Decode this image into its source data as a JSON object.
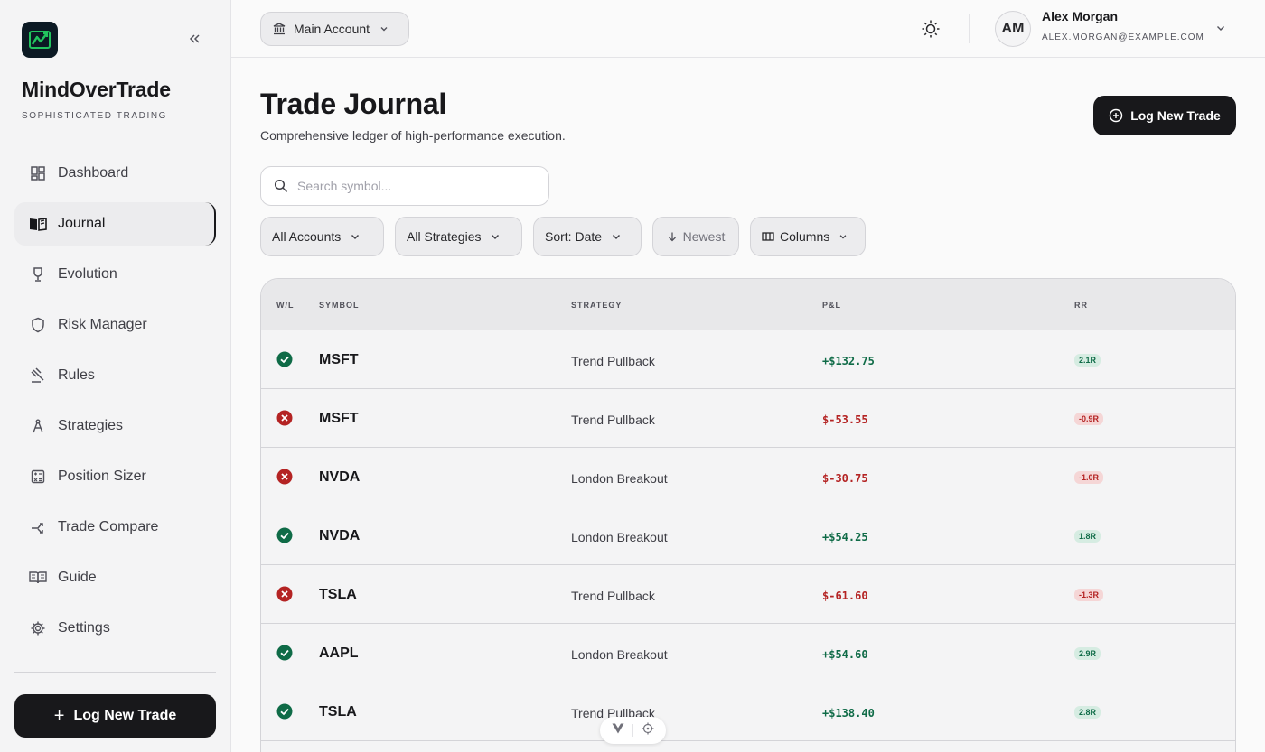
{
  "sidebar": {
    "brand": "MindOverTrade",
    "tagline": "SOPHISTICATED TRADING",
    "items": [
      {
        "label": "Dashboard",
        "icon": "dashboard-icon",
        "active": false
      },
      {
        "label": "Journal",
        "icon": "book-open-icon",
        "active": true
      },
      {
        "label": "Evolution",
        "icon": "trophy-icon",
        "active": false
      },
      {
        "label": "Risk Manager",
        "icon": "shield-icon",
        "active": false
      },
      {
        "label": "Rules",
        "icon": "gavel-icon",
        "active": false
      },
      {
        "label": "Strategies",
        "icon": "compass-icon",
        "active": false
      },
      {
        "label": "Position Sizer",
        "icon": "calculator-icon",
        "active": false
      },
      {
        "label": "Trade Compare",
        "icon": "compare-arrows-icon",
        "active": false
      },
      {
        "label": "Guide",
        "icon": "book-icon",
        "active": false
      },
      {
        "label": "Settings",
        "icon": "gear-icon",
        "active": false
      }
    ],
    "cta": "Log New Trade"
  },
  "topbar": {
    "account": "Main Account",
    "user": {
      "initials": "AM",
      "name": "Alex Morgan",
      "email": "ALEX.MORGAN@EXAMPLE.COM"
    }
  },
  "main": {
    "title": "Trade Journal",
    "subtitle": "Comprehensive ledger of high-performance execution.",
    "log_button": "Log New Trade",
    "search_placeholder": "Search symbol...",
    "filters": {
      "accounts": "All Accounts",
      "strategies": "All Strategies",
      "sort": "Sort: Date",
      "order": "Newest",
      "columns": "Columns"
    },
    "table": {
      "headers": {
        "wl": "W/L",
        "symbol": "SYMBOL",
        "strategy": "STRATEGY",
        "pnl": "P&L",
        "rr": "RR"
      },
      "rows": [
        {
          "win": true,
          "symbol": "MSFT",
          "strategy": "Trend Pullback",
          "pnl": "+$132.75",
          "rr": "2.1R"
        },
        {
          "win": false,
          "symbol": "MSFT",
          "strategy": "Trend Pullback",
          "pnl": "$-53.55",
          "rr": "-0.9R"
        },
        {
          "win": false,
          "symbol": "NVDA",
          "strategy": "London Breakout",
          "pnl": "$-30.75",
          "rr": "-1.0R"
        },
        {
          "win": true,
          "symbol": "NVDA",
          "strategy": "London Breakout",
          "pnl": "+$54.25",
          "rr": "1.8R"
        },
        {
          "win": false,
          "symbol": "TSLA",
          "strategy": "Trend Pullback",
          "pnl": "$-61.60",
          "rr": "-1.3R"
        },
        {
          "win": true,
          "symbol": "AAPL",
          "strategy": "London Breakout",
          "pnl": "+$54.60",
          "rr": "2.9R"
        },
        {
          "win": true,
          "symbol": "TSLA",
          "strategy": "Trend Pullback",
          "pnl": "+$138.40",
          "rr": "2.8R"
        }
      ]
    }
  },
  "colors": {
    "win": "#0f6b47",
    "loss": "#b42323",
    "primary": "#18181b"
  }
}
